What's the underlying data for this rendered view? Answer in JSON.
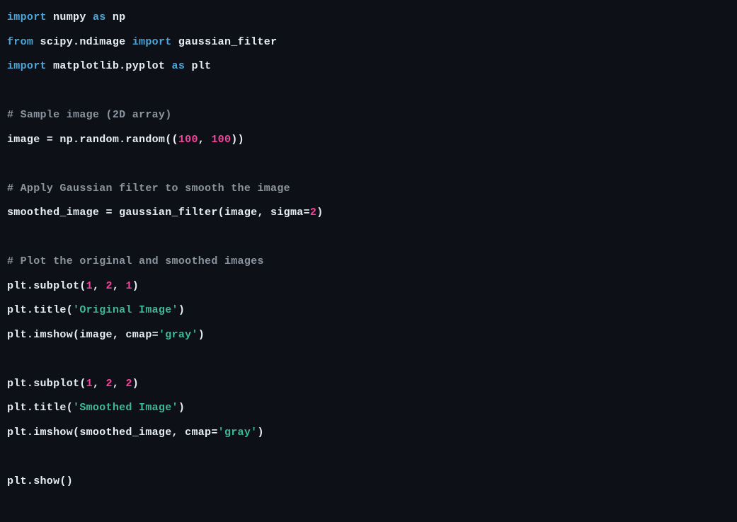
{
  "lines": {
    "l1_import": "import",
    "l1_numpy": " numpy ",
    "l1_as": "as",
    "l1_np": " np",
    "l2_from": "from",
    "l2_scipy": " scipy.ndimage ",
    "l2_import": "import",
    "l2_gf": " gaussian_filter",
    "l3_import": "import",
    "l3_mpl": " matplotlib.pyplot ",
    "l3_as": "as",
    "l3_plt": " plt",
    "l5_comment": "# Sample image (2D array)",
    "l6_a": "image = np.random.random((",
    "l6_n1": "100",
    "l6_b": ", ",
    "l6_n2": "100",
    "l6_c": "))",
    "l8_comment": "# Apply Gaussian filter to smooth the image",
    "l9_a": "smoothed_image = gaussian_filter(image, sigma=",
    "l9_n": "2",
    "l9_b": ")",
    "l11_comment": "# Plot the original and smoothed images",
    "l12_a": "plt.subplot(",
    "l12_n1": "1",
    "l12_b": ", ",
    "l12_n2": "2",
    "l12_c": ", ",
    "l12_n3": "1",
    "l12_d": ")",
    "l13_a": "plt.title(",
    "l13_s": "'Original Image'",
    "l13_b": ")",
    "l14_a": "plt.imshow(image, cmap=",
    "l14_s": "'gray'",
    "l14_b": ")",
    "l16_a": "plt.subplot(",
    "l16_n1": "1",
    "l16_b": ", ",
    "l16_n2": "2",
    "l16_c": ", ",
    "l16_n3": "2",
    "l16_d": ")",
    "l17_a": "plt.title(",
    "l17_s": "'Smoothed Image'",
    "l17_b": ")",
    "l18_a": "plt.imshow(smoothed_image, cmap=",
    "l18_s": "'gray'",
    "l18_b": ")",
    "l20_a": "plt.show()"
  }
}
